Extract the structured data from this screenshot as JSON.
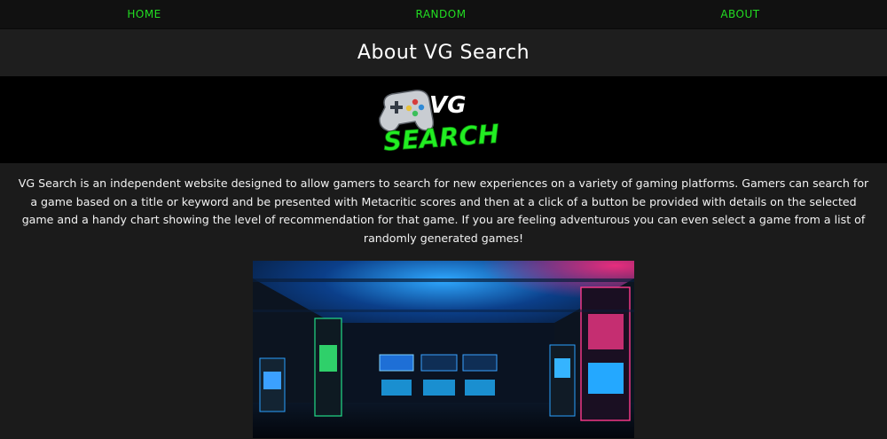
{
  "nav": {
    "home": "HOME",
    "random": "RANDOM",
    "about": "ABOUT"
  },
  "page": {
    "title": "About VG Search"
  },
  "logo": {
    "wordmark_top": "VG",
    "wordmark_bottom": "SEARCH"
  },
  "about": {
    "description": "VG Search is an independent website designed to allow gamers to search for new experiences on a variety of gaming platforms. Gamers can search for a game based on a title or keyword and be presented with Metacritic scores and then at a click of a button be provided with details on the selected game and a handy chart showing the level of recommendation for that game. If you are feeling adventurous you can even select a game from a list of randomly generated games!"
  },
  "colors": {
    "accent": "#22dd22",
    "background": "#1b1b1b",
    "nav_background": "#111111",
    "logo_band": "#000000"
  }
}
